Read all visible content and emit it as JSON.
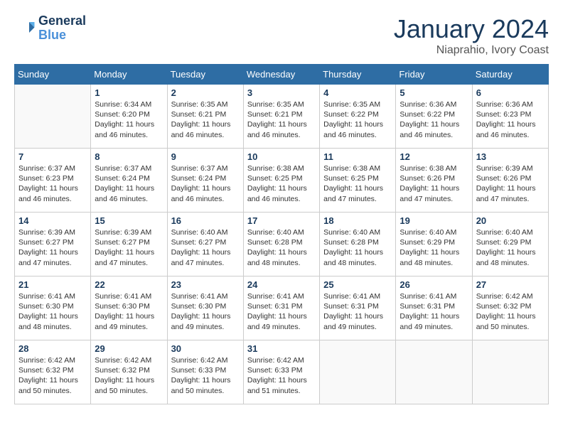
{
  "header": {
    "logo_line1": "General",
    "logo_line2": "Blue",
    "month": "January 2024",
    "location": "Niaprahio, Ivory Coast"
  },
  "weekdays": [
    "Sunday",
    "Monday",
    "Tuesday",
    "Wednesday",
    "Thursday",
    "Friday",
    "Saturday"
  ],
  "weeks": [
    [
      {
        "day": "",
        "sunrise": "",
        "sunset": "",
        "daylight": ""
      },
      {
        "day": "1",
        "sunrise": "Sunrise: 6:34 AM",
        "sunset": "Sunset: 6:20 PM",
        "daylight": "Daylight: 11 hours and 46 minutes."
      },
      {
        "day": "2",
        "sunrise": "Sunrise: 6:35 AM",
        "sunset": "Sunset: 6:21 PM",
        "daylight": "Daylight: 11 hours and 46 minutes."
      },
      {
        "day": "3",
        "sunrise": "Sunrise: 6:35 AM",
        "sunset": "Sunset: 6:21 PM",
        "daylight": "Daylight: 11 hours and 46 minutes."
      },
      {
        "day": "4",
        "sunrise": "Sunrise: 6:35 AM",
        "sunset": "Sunset: 6:22 PM",
        "daylight": "Daylight: 11 hours and 46 minutes."
      },
      {
        "day": "5",
        "sunrise": "Sunrise: 6:36 AM",
        "sunset": "Sunset: 6:22 PM",
        "daylight": "Daylight: 11 hours and 46 minutes."
      },
      {
        "day": "6",
        "sunrise": "Sunrise: 6:36 AM",
        "sunset": "Sunset: 6:23 PM",
        "daylight": "Daylight: 11 hours and 46 minutes."
      }
    ],
    [
      {
        "day": "7",
        "sunrise": "Sunrise: 6:37 AM",
        "sunset": "Sunset: 6:23 PM",
        "daylight": "Daylight: 11 hours and 46 minutes."
      },
      {
        "day": "8",
        "sunrise": "Sunrise: 6:37 AM",
        "sunset": "Sunset: 6:24 PM",
        "daylight": "Daylight: 11 hours and 46 minutes."
      },
      {
        "day": "9",
        "sunrise": "Sunrise: 6:37 AM",
        "sunset": "Sunset: 6:24 PM",
        "daylight": "Daylight: 11 hours and 46 minutes."
      },
      {
        "day": "10",
        "sunrise": "Sunrise: 6:38 AM",
        "sunset": "Sunset: 6:25 PM",
        "daylight": "Daylight: 11 hours and 46 minutes."
      },
      {
        "day": "11",
        "sunrise": "Sunrise: 6:38 AM",
        "sunset": "Sunset: 6:25 PM",
        "daylight": "Daylight: 11 hours and 47 minutes."
      },
      {
        "day": "12",
        "sunrise": "Sunrise: 6:38 AM",
        "sunset": "Sunset: 6:26 PM",
        "daylight": "Daylight: 11 hours and 47 minutes."
      },
      {
        "day": "13",
        "sunrise": "Sunrise: 6:39 AM",
        "sunset": "Sunset: 6:26 PM",
        "daylight": "Daylight: 11 hours and 47 minutes."
      }
    ],
    [
      {
        "day": "14",
        "sunrise": "Sunrise: 6:39 AM",
        "sunset": "Sunset: 6:27 PM",
        "daylight": "Daylight: 11 hours and 47 minutes."
      },
      {
        "day": "15",
        "sunrise": "Sunrise: 6:39 AM",
        "sunset": "Sunset: 6:27 PM",
        "daylight": "Daylight: 11 hours and 47 minutes."
      },
      {
        "day": "16",
        "sunrise": "Sunrise: 6:40 AM",
        "sunset": "Sunset: 6:27 PM",
        "daylight": "Daylight: 11 hours and 47 minutes."
      },
      {
        "day": "17",
        "sunrise": "Sunrise: 6:40 AM",
        "sunset": "Sunset: 6:28 PM",
        "daylight": "Daylight: 11 hours and 48 minutes."
      },
      {
        "day": "18",
        "sunrise": "Sunrise: 6:40 AM",
        "sunset": "Sunset: 6:28 PM",
        "daylight": "Daylight: 11 hours and 48 minutes."
      },
      {
        "day": "19",
        "sunrise": "Sunrise: 6:40 AM",
        "sunset": "Sunset: 6:29 PM",
        "daylight": "Daylight: 11 hours and 48 minutes."
      },
      {
        "day": "20",
        "sunrise": "Sunrise: 6:40 AM",
        "sunset": "Sunset: 6:29 PM",
        "daylight": "Daylight: 11 hours and 48 minutes."
      }
    ],
    [
      {
        "day": "21",
        "sunrise": "Sunrise: 6:41 AM",
        "sunset": "Sunset: 6:30 PM",
        "daylight": "Daylight: 11 hours and 48 minutes."
      },
      {
        "day": "22",
        "sunrise": "Sunrise: 6:41 AM",
        "sunset": "Sunset: 6:30 PM",
        "daylight": "Daylight: 11 hours and 49 minutes."
      },
      {
        "day": "23",
        "sunrise": "Sunrise: 6:41 AM",
        "sunset": "Sunset: 6:30 PM",
        "daylight": "Daylight: 11 hours and 49 minutes."
      },
      {
        "day": "24",
        "sunrise": "Sunrise: 6:41 AM",
        "sunset": "Sunset: 6:31 PM",
        "daylight": "Daylight: 11 hours and 49 minutes."
      },
      {
        "day": "25",
        "sunrise": "Sunrise: 6:41 AM",
        "sunset": "Sunset: 6:31 PM",
        "daylight": "Daylight: 11 hours and 49 minutes."
      },
      {
        "day": "26",
        "sunrise": "Sunrise: 6:41 AM",
        "sunset": "Sunset: 6:31 PM",
        "daylight": "Daylight: 11 hours and 49 minutes."
      },
      {
        "day": "27",
        "sunrise": "Sunrise: 6:42 AM",
        "sunset": "Sunset: 6:32 PM",
        "daylight": "Daylight: 11 hours and 50 minutes."
      }
    ],
    [
      {
        "day": "28",
        "sunrise": "Sunrise: 6:42 AM",
        "sunset": "Sunset: 6:32 PM",
        "daylight": "Daylight: 11 hours and 50 minutes."
      },
      {
        "day": "29",
        "sunrise": "Sunrise: 6:42 AM",
        "sunset": "Sunset: 6:32 PM",
        "daylight": "Daylight: 11 hours and 50 minutes."
      },
      {
        "day": "30",
        "sunrise": "Sunrise: 6:42 AM",
        "sunset": "Sunset: 6:33 PM",
        "daylight": "Daylight: 11 hours and 50 minutes."
      },
      {
        "day": "31",
        "sunrise": "Sunrise: 6:42 AM",
        "sunset": "Sunset: 6:33 PM",
        "daylight": "Daylight: 11 hours and 51 minutes."
      },
      {
        "day": "",
        "sunrise": "",
        "sunset": "",
        "daylight": ""
      },
      {
        "day": "",
        "sunrise": "",
        "sunset": "",
        "daylight": ""
      },
      {
        "day": "",
        "sunrise": "",
        "sunset": "",
        "daylight": ""
      }
    ]
  ]
}
